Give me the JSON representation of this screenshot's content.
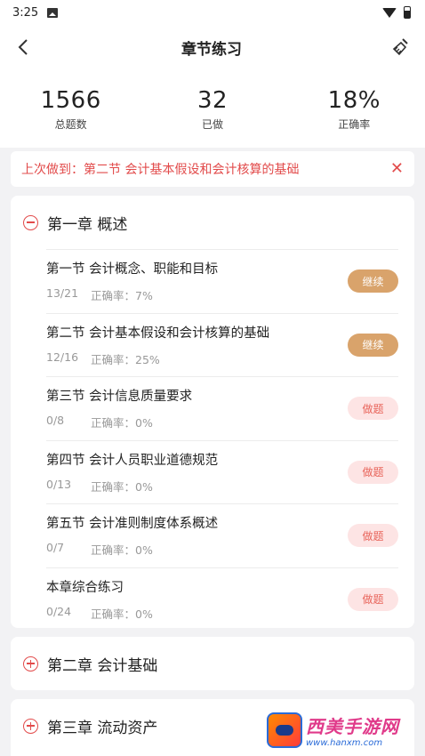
{
  "status_bar": {
    "time": "3:25"
  },
  "header": {
    "title": "章节练习"
  },
  "stats": [
    {
      "value": "1566",
      "label": "总题数"
    },
    {
      "value": "32",
      "label": "已做"
    },
    {
      "value": "18%",
      "label": "正确率"
    }
  ],
  "last_done": {
    "text": "上次做到：第二节 会计基本假设和会计核算的基础",
    "close": "✕"
  },
  "chapters": [
    {
      "title": "第一章 概述",
      "expanded": true,
      "sections": [
        {
          "title": "第一节 会计概念、职能和目标",
          "count": "13/21",
          "accuracy": "正确率：7%",
          "action": "继续"
        },
        {
          "title": "第二节 会计基本假设和会计核算的基础",
          "count": "12/16",
          "accuracy": "正确率：25%",
          "action": "继续"
        },
        {
          "title": "第三节 会计信息质量要求",
          "count": "0/8",
          "accuracy": "正确率：0%",
          "action": "做题"
        },
        {
          "title": "第四节 会计人员职业道德规范",
          "count": "0/13",
          "accuracy": "正确率：0%",
          "action": "做题"
        },
        {
          "title": "第五节 会计准则制度体系概述",
          "count": "0/7",
          "accuracy": "正确率：0%",
          "action": "做题"
        },
        {
          "title": "本章综合练习",
          "count": "0/24",
          "accuracy": "正确率：0%",
          "action": "做题"
        }
      ]
    },
    {
      "title": "第二章 会计基础",
      "expanded": false
    },
    {
      "title": "第三章 流动资产",
      "expanded": false
    }
  ],
  "watermark": {
    "name": "西美手游网",
    "url": "www.hanxm.com"
  },
  "colors": {
    "accent_red": "#e24b4b",
    "continue_bg": "#d9a36b",
    "do_bg": "#fde4e4"
  }
}
